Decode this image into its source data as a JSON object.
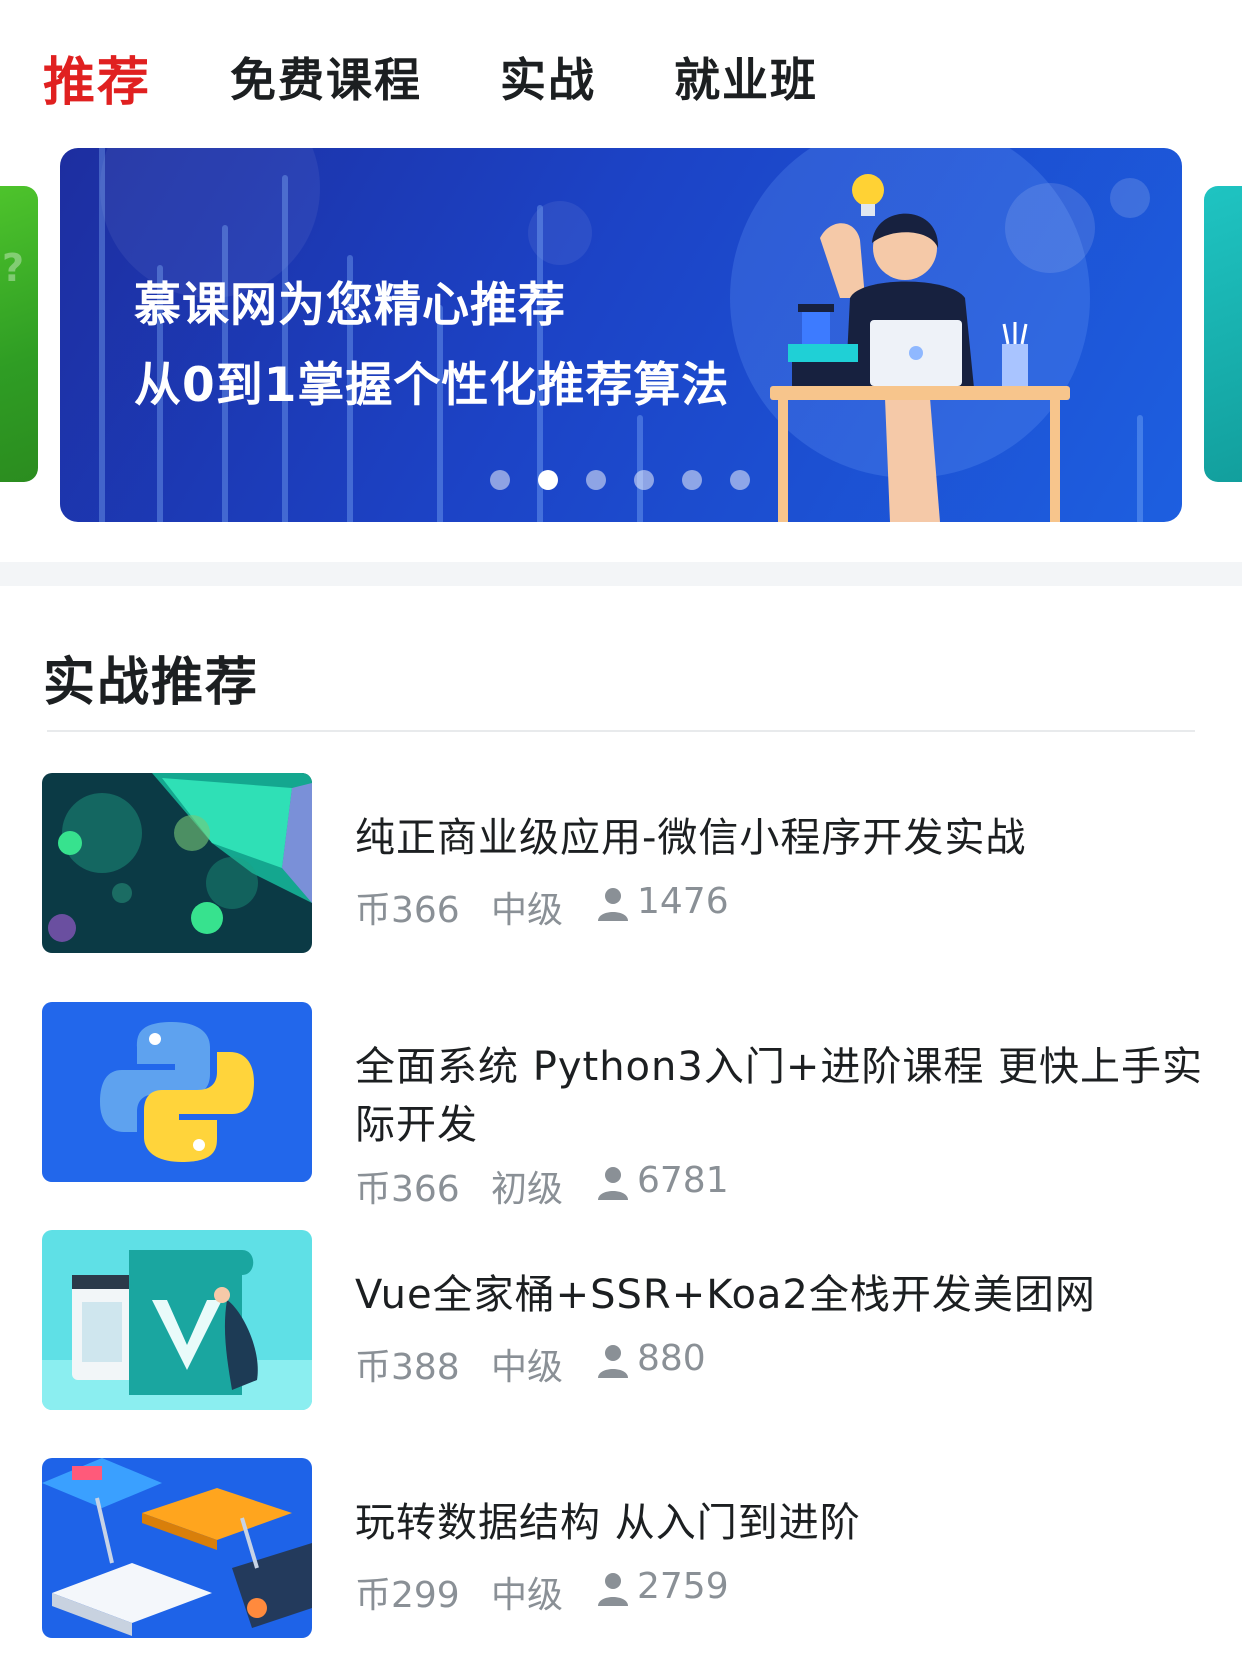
{
  "tabs": [
    {
      "label": "推荐",
      "active": true
    },
    {
      "label": "免费课程",
      "active": false
    },
    {
      "label": "实战",
      "active": false
    },
    {
      "label": "就业班",
      "active": false
    }
  ],
  "banner": {
    "line1": "慕课网为您精心推荐",
    "line2": "从0到1掌握个性化推荐算法",
    "dots_total": 6,
    "active_dot": 2
  },
  "section": {
    "title": "实战推荐"
  },
  "courses": [
    {
      "title": "纯正商业级应用-微信小程序开发实战",
      "price": "币366",
      "level": "中级",
      "students": "1476",
      "thumb_icon": "wechat-miniprogram-thumbnail"
    },
    {
      "title": "全面系统 Python3入门+进阶课程 更快上手实际开发",
      "price": "币366",
      "level": "初级",
      "students": "6781",
      "thumb_icon": "python-logo-thumbnail"
    },
    {
      "title": "Vue全家桶+SSR+Koa2全栈开发美团网",
      "price": "币388",
      "level": "中级",
      "students": "880",
      "thumb_icon": "vue-logo-thumbnail"
    },
    {
      "title": "玩转数据结构 从入门到进阶",
      "price": "币299",
      "level": "中级",
      "students": "2759",
      "thumb_icon": "data-structure-thumbnail"
    }
  ],
  "colors": {
    "accent": "#e02020",
    "text": "#1c1f21",
    "meta": "#8a9096",
    "banner_blue": "#1c43c6"
  }
}
